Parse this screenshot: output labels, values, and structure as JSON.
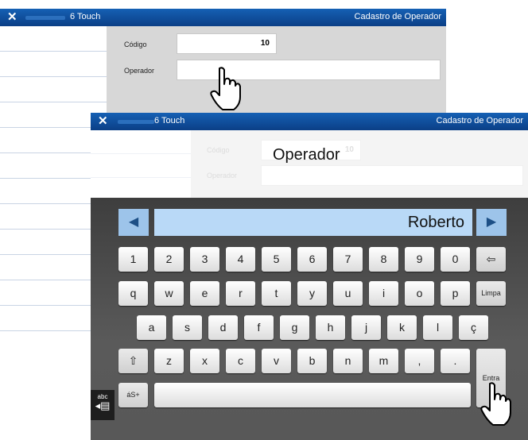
{
  "back_window": {
    "title_app": "6 Touch",
    "title_form": "Cadastro de Operador",
    "codigo_label": "Código",
    "codigo_value": "10",
    "operador_label": "Operador",
    "operador_value": ""
  },
  "front_window": {
    "title_app": "6 Touch",
    "title_form": "Cadastro de Operador",
    "codigo_label": "Código",
    "codigo_value": "10",
    "operador_label": "Operador",
    "field_caption": "Operador",
    "input_value": "Roberto",
    "keyboard": {
      "prev_symbol": "◀",
      "next_symbol": "▶",
      "row1": [
        "1",
        "2",
        "3",
        "4",
        "5",
        "6",
        "7",
        "8",
        "9",
        "0"
      ],
      "backspace_symbol": "⇦",
      "row2": [
        "q",
        "w",
        "e",
        "r",
        "t",
        "y",
        "u",
        "i",
        "o",
        "p"
      ],
      "limpa": "Limpa",
      "row3": [
        "a",
        "s",
        "d",
        "f",
        "g",
        "h",
        "j",
        "k",
        "l",
        "ç"
      ],
      "shift_symbol": "⇧",
      "row4": [
        "z",
        "x",
        "c",
        "v",
        "b",
        "n",
        "m",
        ",",
        "."
      ],
      "entra": "Entra",
      "alt_key": "áS+",
      "abc_label": "abc"
    }
  },
  "colors": {
    "titlebar": "#0b3f86",
    "display": "#b9d9f7",
    "nav_button": "#9dc4ea"
  },
  "icons": [
    "close-icon",
    "hand-cursor-icon",
    "left-arrow-icon",
    "right-arrow-icon",
    "backspace-icon",
    "shift-icon",
    "keyboard-icon"
  ]
}
